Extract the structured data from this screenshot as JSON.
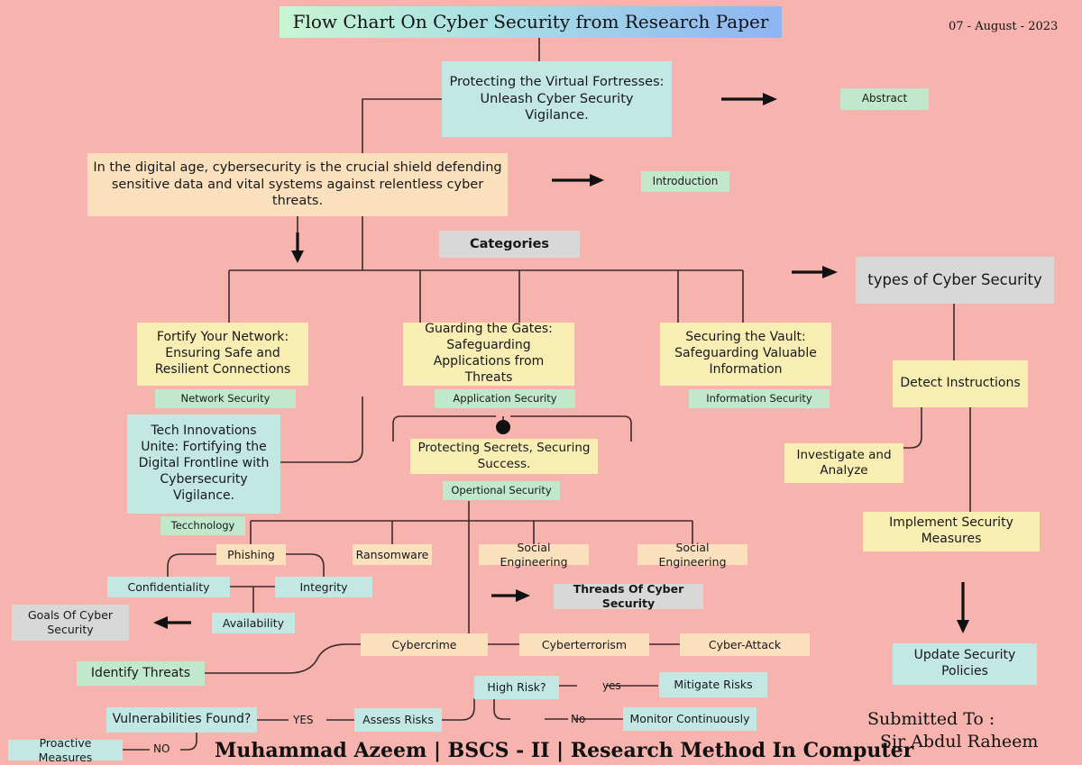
{
  "meta": {
    "title": "Flow Chart On Cyber Security from Research Paper",
    "date": "07 - August - 2023",
    "footer": "Muhammad Azeem | BSCS - II | Research Method In Computer",
    "submitted_to_line1": "Submitted To :",
    "submitted_to_line2": "Sir Abdul Raheem",
    "background_color": "#f7b3ad"
  },
  "colors": {
    "blue": "#c3e7e3",
    "yellow": "#f8eeb4",
    "green": "#c2e8cc",
    "peach": "#fbe0bd",
    "grey": "#d8d8d8",
    "line": "#3a2b2b"
  },
  "sections": {
    "abstract": {
      "statement": "Protecting the Virtual Fortresses: Unleash Cyber Security Vigilance.",
      "tag": "Abstract"
    },
    "introduction": {
      "statement": "In the digital age, cybersecurity is the crucial shield defending sensitive data and vital systems against relentless cyber threats.",
      "tag": "Introduction"
    },
    "categories": {
      "heading": "Categories",
      "items": [
        {
          "statement": "Fortify Your Network: Ensuring Safe and Resilient Connections",
          "tag": "Network Security"
        },
        {
          "statement": "Guarding the Gates: Safeguarding Applications from Threats",
          "tag": "Application Security"
        },
        {
          "statement": "Securing the Vault: Safeguarding Valuable Information",
          "tag": "Information Security"
        },
        {
          "statement": "Tech Innovations Unite: Fortifying the Digital Frontline with Cybersecurity Vigilance.",
          "tag": "Tecchnology"
        },
        {
          "statement": "Protecting Secrets, Securing Success.",
          "tag": "Opertional Security"
        }
      ]
    },
    "types_of_cyber_security": {
      "heading": "types of Cyber Security",
      "steps": [
        "Detect Instructions",
        "Investigate and Analyze",
        "Implement Security Measures",
        "Update Security Policies"
      ]
    },
    "threats": {
      "heading": "Threads Of Cyber Security",
      "items": [
        "Phishing",
        "Ransomware",
        "Social Engineering",
        "Social Engineering",
        "Cybercrime",
        "Cyberterrorism",
        "Cyber-Attack"
      ]
    },
    "goals": {
      "heading": "Goals Of Cyber Security",
      "items": [
        "Confidentiality",
        "Integrity",
        "Availability"
      ]
    },
    "risk_process": {
      "start": "Identify Threats",
      "decision_1": "Vulnerabilities Found?",
      "decision_1_yes": "YES",
      "decision_1_no": "NO",
      "no_branch": "Proactive Measures",
      "assess": "Assess Risks",
      "decision_2": "High Risk?",
      "decision_2_yes": "yes",
      "decision_2_no": "No",
      "yes_branch": "Mitigate Risks",
      "no_branch_2": "Monitor Continuously"
    }
  }
}
